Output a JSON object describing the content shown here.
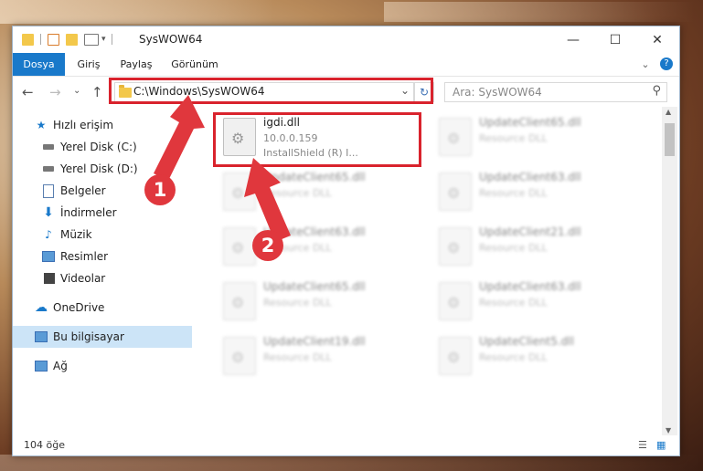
{
  "window": {
    "title": "SysWOW64",
    "minimize": "—",
    "maximize": "☐",
    "close": "✕"
  },
  "ribbon": {
    "tabs": [
      {
        "label": "Dosya",
        "active": true
      },
      {
        "label": "Giriş",
        "active": false
      },
      {
        "label": "Paylaş",
        "active": false
      },
      {
        "label": "Görünüm",
        "active": false
      }
    ],
    "expand": "⌄",
    "help": "?"
  },
  "nav": {
    "back": "←",
    "forward": "→",
    "recent": "⌄",
    "up": "↑",
    "address": "C:\\Windows\\SysWOW64",
    "address_dropdown": "⌄",
    "refresh": "↻",
    "search_placeholder": "Ara: SysWOW64",
    "search_icon": "⚲"
  },
  "sidebar": {
    "items": [
      {
        "label": "Hızlı erişim",
        "icon": "star-icon",
        "pinned": false
      },
      {
        "label": "Yerel Disk (C:)",
        "icon": "drive-icon",
        "pinned": true
      },
      {
        "label": "Yerel Disk (D:)",
        "icon": "drive-icon",
        "pinned": true
      },
      {
        "label": "Belgeler",
        "icon": "documents-icon",
        "pinned": true
      },
      {
        "label": "İndirmeler",
        "icon": "download-icon",
        "pinned": true
      },
      {
        "label": "Müzik",
        "icon": "music-icon",
        "pinned": true
      },
      {
        "label": "Resimler",
        "icon": "pictures-icon",
        "pinned": true
      },
      {
        "label": "Videolar",
        "icon": "videos-icon",
        "pinned": true
      },
      {
        "label": "OneDrive",
        "icon": "cloud-icon",
        "pinned": false
      },
      {
        "label": "Bu bilgisayar",
        "icon": "computer-icon",
        "pinned": false,
        "selected": true
      },
      {
        "label": "Ağ",
        "icon": "network-icon",
        "pinned": false
      }
    ]
  },
  "files": [
    {
      "name": "igdi.dll",
      "version": "10.0.0.159",
      "desc": "InstallShield (R) I...",
      "highlighted": true
    },
    {
      "name": "UpdateClient65.dll",
      "desc": "Resource DLL"
    },
    {
      "name": "UpdateClient65.dll",
      "desc": "Resource DLL"
    },
    {
      "name": "UpdateClient63.dll",
      "desc": "Resource DLL"
    },
    {
      "name": "UpdateClient63.dll",
      "desc": "Resource DLL"
    },
    {
      "name": "UpdateClient21.dll",
      "desc": "Resource DLL"
    },
    {
      "name": "UpdateClient65.dll",
      "desc": "Resource DLL"
    },
    {
      "name": "UpdateClient63.dll",
      "desc": "Resource DLL"
    },
    {
      "name": "UpdateClient19.dll",
      "desc": "Resource DLL"
    },
    {
      "name": "UpdateClient5.dll",
      "desc": "Resource DLL"
    }
  ],
  "status": {
    "count": "104 öğe"
  },
  "annotations": {
    "step1": "1",
    "step2": "2"
  },
  "colors": {
    "accent": "#1979ca",
    "highlight": "#d9232d",
    "selected": "#cce4f7"
  }
}
